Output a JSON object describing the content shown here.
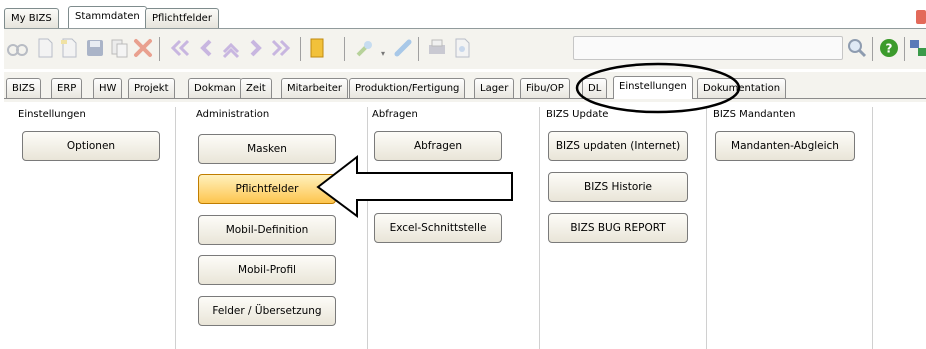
{
  "top_tabs": [
    {
      "label": "My BIZS"
    },
    {
      "label": "Stammdaten"
    },
    {
      "label": "Pflichtfelder"
    }
  ],
  "module_tabs": [
    {
      "label": "BIZS"
    },
    {
      "label": "ERP"
    },
    {
      "label": "HW"
    },
    {
      "label": "Projekt"
    },
    {
      "label": "Dokman"
    },
    {
      "label": "Zeit"
    },
    {
      "label": "Mitarbeiter"
    },
    {
      "label": "Produktion/Fertigung"
    },
    {
      "label": "Lager"
    },
    {
      "label": "Fibu/OP"
    },
    {
      "label": "DL"
    },
    {
      "label": "Einstellungen"
    },
    {
      "label": "Dokumentation"
    }
  ],
  "columns": [
    {
      "title": "Einstellungen",
      "buttons": [
        "Optionen"
      ]
    },
    {
      "title": "Administration",
      "buttons": [
        "Masken",
        "Pflichtfelder",
        "Mobil-Definition",
        "Mobil-Profil",
        "Felder / Übersetzung"
      ]
    },
    {
      "title": "Abfragen",
      "buttons": [
        "Abfragen",
        "Excel-Schnittstelle"
      ]
    },
    {
      "title": "BIZS Update",
      "buttons": [
        "BIZS updaten (Internet)",
        "BIZS Historie",
        "BIZS BUG REPORT"
      ]
    },
    {
      "title": "BIZS Mandanten",
      "buttons": [
        "Mandanten-Abgleich"
      ]
    }
  ],
  "toolbar_icons": [
    "binoculars-icon",
    "new-document-icon",
    "open-folder-icon",
    "save-icon",
    "copy-icon",
    "delete-icon",
    "first-record-icon",
    "previous-record-icon",
    "up-icon",
    "next-record-icon",
    "last-record-icon",
    "exit-icon",
    "tools-icon",
    "link-icon",
    "print-icon",
    "preview-icon",
    "search-icon",
    "help-icon",
    "connect-icon"
  ],
  "accent_color": "#fdc54e"
}
